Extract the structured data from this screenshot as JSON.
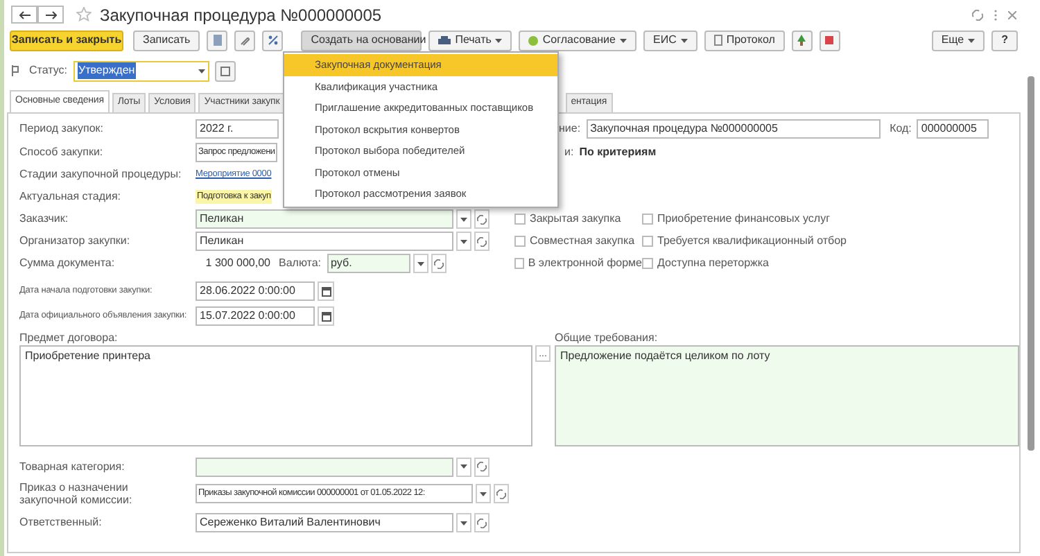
{
  "window": {
    "title": "Закупочная процедура №000000005"
  },
  "toolbar": {
    "save_close": "Записать и закрыть",
    "save": "Записать",
    "create_based_on": {
      "label": "Создать на основании",
      "expanded": true
    },
    "print": "Печать",
    "approval": "Согласование",
    "eis": "ЕИС",
    "protocol": "Протокол",
    "more": "Еще",
    "help": "?"
  },
  "menu": [
    {
      "label": "Закупочная документация",
      "selected": true
    },
    {
      "label": "Квалификация участника",
      "selected": false
    },
    {
      "label": "Приглашение аккредитованных поставщиков",
      "selected": false
    },
    {
      "label": "Протокол вскрытия конвертов",
      "selected": false
    },
    {
      "label": "Протокол выбора победителей",
      "selected": false
    },
    {
      "label": "Протокол отмены",
      "selected": false
    },
    {
      "label": "Протокол рассмотрения заявок",
      "selected": false
    }
  ],
  "status": {
    "label": "Статус:",
    "value": "Утвержден",
    "highlighted": true
  },
  "tabs": [
    {
      "label": "Основные сведения",
      "selected": true
    },
    {
      "label": "Лоты",
      "selected": false
    },
    {
      "label": "Условия",
      "selected": false
    },
    {
      "label": "Участники закупк",
      "selected": false
    },
    {
      "label": "ентация",
      "selected": false
    }
  ],
  "form": {
    "period": {
      "label": "Период закупок:",
      "value": "2022 г."
    },
    "name": {
      "label": "ние:",
      "value": "Закупочная процедура №000000005"
    },
    "code": {
      "label": "Код:",
      "value": "000000005"
    },
    "method": {
      "label": "Способ закупки:",
      "value": "Запрос предложени"
    },
    "evaluation": {
      "label": "и:",
      "value": "По критериям"
    },
    "stage": {
      "label": "Стадии закупочной процедуры:",
      "value": "Мероприятие 0000"
    },
    "current_stage": {
      "label": "Актуальная стадия:",
      "value": "Подготовка к закуп"
    },
    "customer": {
      "label": "Заказчик:",
      "value": "Пеликан"
    },
    "organizer": {
      "label": "Организатор закупки:",
      "value": "Пеликан"
    },
    "amount": {
      "label": "Сумма документа:",
      "value": "1 300 000,00",
      "currency_label": "Валюта:",
      "currency": "руб."
    },
    "checkboxes": [
      {
        "label": "Закрытая закупка",
        "checked": false
      },
      {
        "label": "Приобретение финансовых услуг",
        "checked": false
      },
      {
        "label": "Совместная закупка",
        "checked": false
      },
      {
        "label": "Требуется квалификационный отбор",
        "checked": false
      },
      {
        "label": "В электронной форме",
        "checked": false
      },
      {
        "label": "Доступна переторжка",
        "checked": false
      }
    ],
    "start_date": {
      "label": "Дата начала подготовки закупки:",
      "value": "28.06.2022  0:00:00"
    },
    "announce_date": {
      "label": "Дата официального объявления закупки:",
      "value": "15.07.2022  0:00:00"
    },
    "subject": {
      "label": "Предмет договора:",
      "value": "Приобретение принтера",
      "button": "..."
    },
    "requirements": {
      "label": "Общие требования:",
      "value": "Предложение подаётся целиком по лоту"
    },
    "category": {
      "label": "Товарная категория:"
    },
    "order": {
      "label": "Приказ о назначении закупочной комиссии:",
      "value": "Приказы закупочной комиссии 000000001 от 01.05.2022 12:"
    },
    "responsible": {
      "label": "Ответственный:",
      "value": "Сереженко Виталий Валентинович"
    }
  }
}
